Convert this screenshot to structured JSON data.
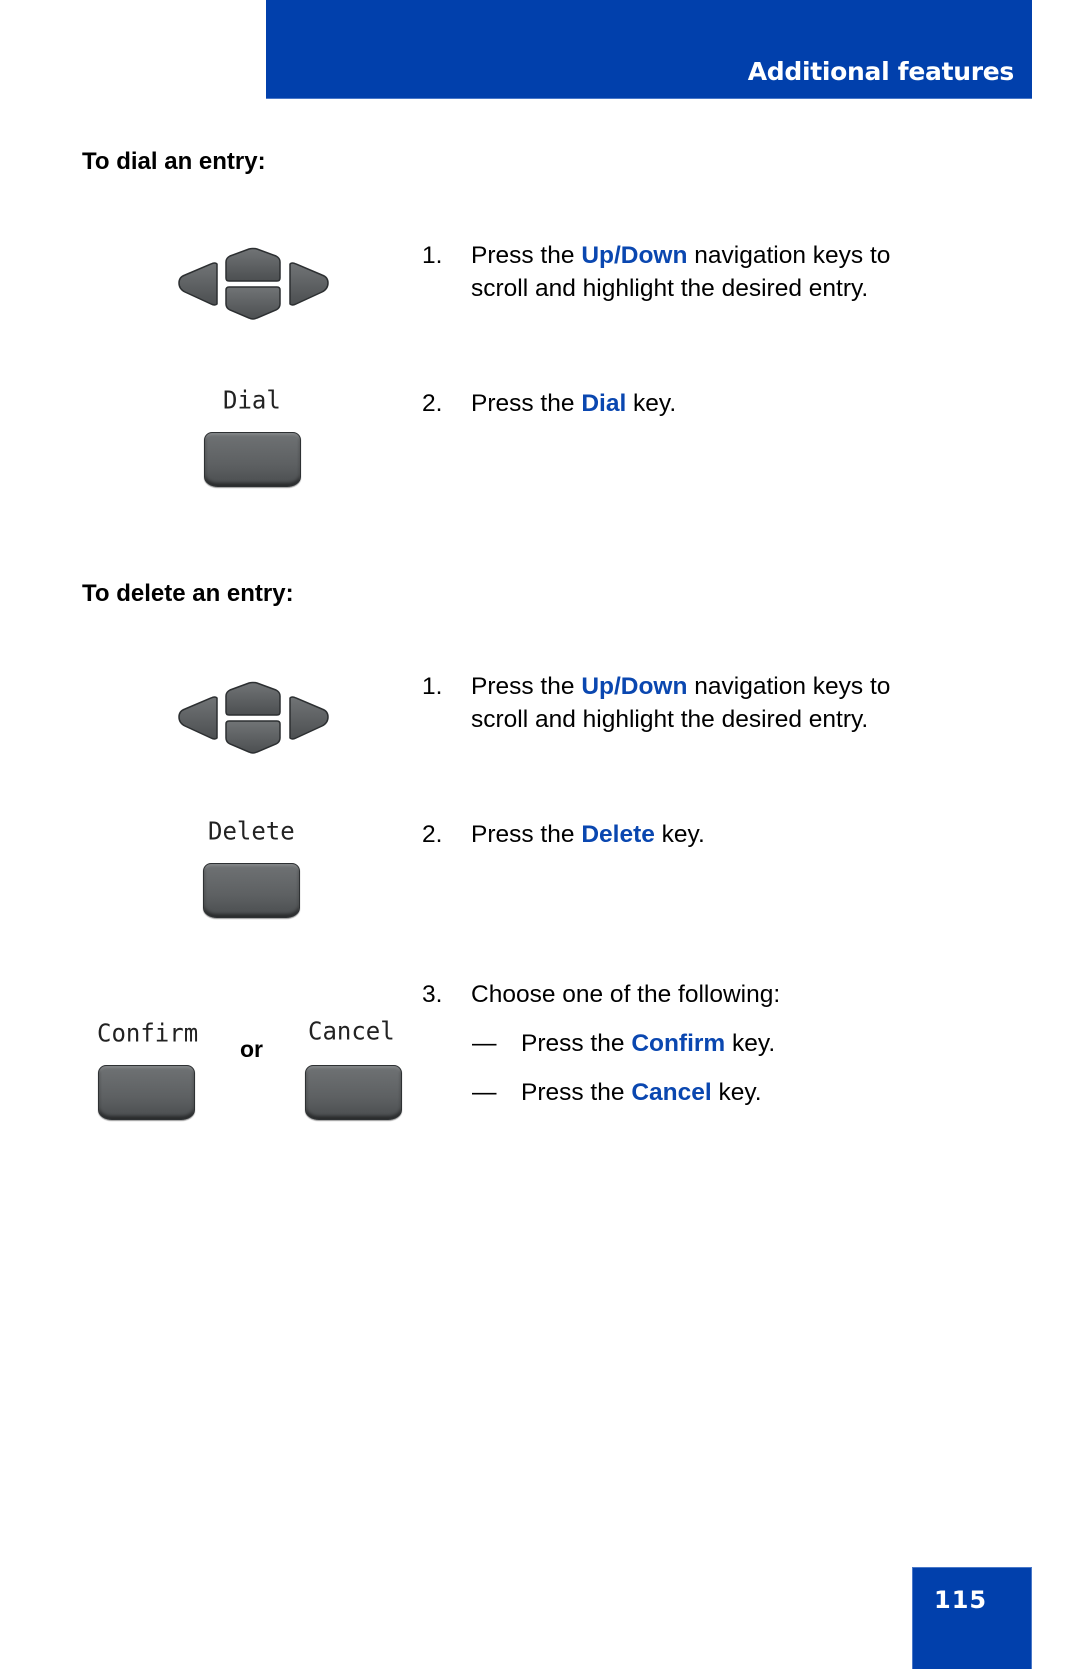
{
  "header": {
    "title": "Additional features",
    "bar_color": "#0140ac"
  },
  "sections": [
    {
      "heading": "To dial an entry:",
      "steps": [
        {
          "number": "1.",
          "pre": "Press the ",
          "highlight": "Up/Down",
          "post": " navigation keys to",
          "line2": "scroll and highlight the desired entry.",
          "icon": "navigation-cluster-icon"
        },
        {
          "number": "2.",
          "pre": "Press the ",
          "highlight": "Dial",
          "post": " key.",
          "key_label": "Dial",
          "icon": "softkey-icon"
        }
      ]
    },
    {
      "heading": "To delete an entry:",
      "steps": [
        {
          "number": "1.",
          "pre": "Press the ",
          "highlight": "Up/Down",
          "post": " navigation keys to",
          "line2": "scroll and highlight the desired entry.",
          "icon": "navigation-cluster-icon"
        },
        {
          "number": "2.",
          "pre": "Press the ",
          "highlight": "Delete",
          "post": " key.",
          "key_label": "Delete",
          "icon": "softkey-icon"
        },
        {
          "number": "3.",
          "text": "Choose one of the following:",
          "options": [
            {
              "dash": "—",
              "pre": "Press the ",
              "highlight": "Confirm",
              "post": " key."
            },
            {
              "dash": "—",
              "pre": "Press the ",
              "highlight": "Cancel",
              "post": " key."
            }
          ],
          "key_labels": [
            "Confirm",
            "Cancel"
          ],
          "or_label": "or"
        }
      ]
    }
  ],
  "footer": {
    "page_number": "115"
  },
  "colors": {
    "highlight": "#0a47b0",
    "key_gray": "#5f6264"
  }
}
